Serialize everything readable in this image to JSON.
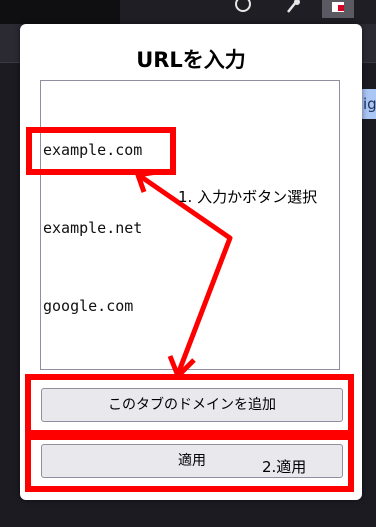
{
  "browser": {
    "toolbar_icons": [
      "shield-icon",
      "puzzle-icon",
      "extension-icon"
    ],
    "side_tab_text": "ig"
  },
  "popup": {
    "title": "URLを入力",
    "url_lines": [
      "example.com",
      "example.net",
      "google.com"
    ],
    "add_button_label": "このタブのドメインを追加",
    "apply_button_label": "適用"
  },
  "annotations": {
    "step1": "1. 入力かボタン選択",
    "step2": "2.適用",
    "color": "#ff0000"
  }
}
